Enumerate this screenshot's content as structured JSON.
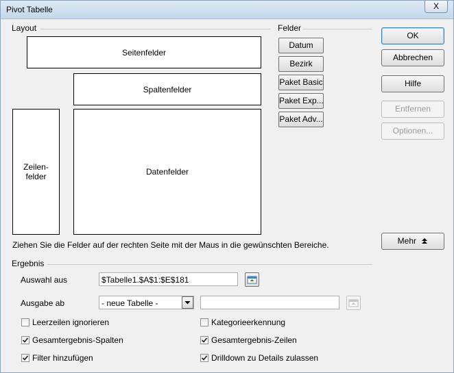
{
  "window": {
    "title": "Pivot Tabelle",
    "close_label": "X"
  },
  "layout": {
    "label": "Layout",
    "page_fields": "Seitenfelder",
    "column_fields": "Spaltenfelder",
    "row_fields_line1": "Zeilen-",
    "row_fields_line2": "felder",
    "data_fields": "Datenfelder",
    "hint": "Ziehen Sie die Felder auf der rechten Seite mit der Maus in die gewünschten Bereiche."
  },
  "fields": {
    "label": "Felder",
    "items": [
      "Datum",
      "Bezirk",
      "Paket Basic",
      "Paket Exp...",
      "Paket Adv..."
    ]
  },
  "buttons": {
    "ok": "OK",
    "cancel": "Abbrechen",
    "help": "Hilfe",
    "remove": "Entfernen",
    "options": "Optionen...",
    "more": "Mehr"
  },
  "result": {
    "label": "Ergebnis",
    "selection_label": "Auswahl aus",
    "selection_value": "$Tabelle1.$A$1:$E$181",
    "output_label": "Ausgabe ab",
    "output_selected": "- neue Tabelle -",
    "output_target_value": ""
  },
  "options": {
    "ignore_empty_rows": {
      "label": "Leerzeilen ignorieren",
      "checked": false
    },
    "identify_categories": {
      "label": "Kategorieerkennung",
      "checked": false
    },
    "total_columns": {
      "label": "Gesamtergebnis-Spalten",
      "checked": true
    },
    "total_rows": {
      "label": "Gesamtergebnis-Zeilen",
      "checked": true
    },
    "add_filter": {
      "label": "Filter hinzufügen",
      "checked": true
    },
    "drilldown": {
      "label": "Drilldown zu Details zulassen",
      "checked": true
    }
  }
}
